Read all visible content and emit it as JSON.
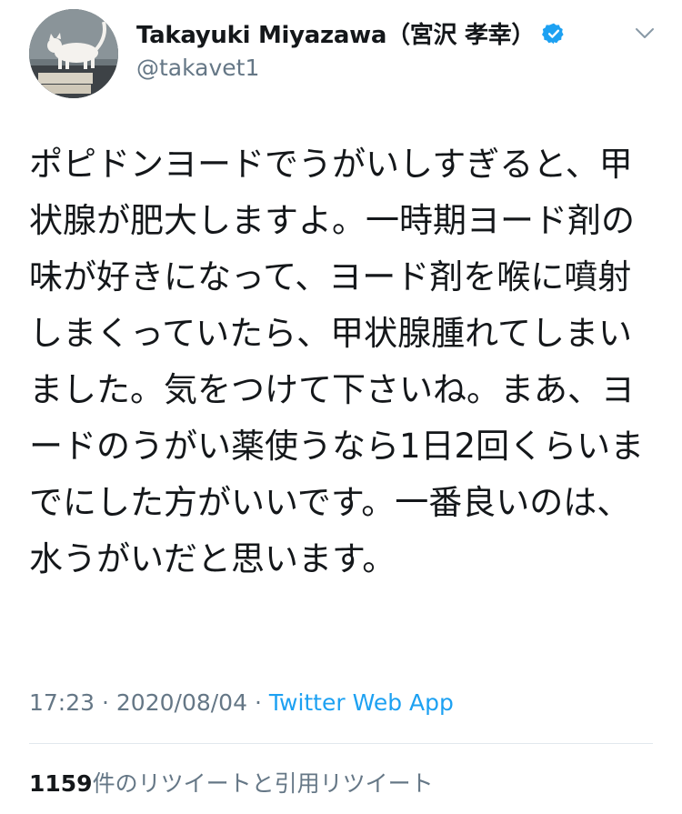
{
  "author": {
    "display_name": "Takayuki Miyazawa（宮沢 孝幸）",
    "handle": "@takavet1",
    "avatar_icon": "cat-photo-avatar",
    "verified_icon": "verified-badge-icon"
  },
  "tweet": {
    "text": "ポピドンヨードでうがいしすぎると、甲状腺が肥大しますよ。一時期ヨード剤の味が好きになって、ヨード剤を喉に噴射しまくっていたら、甲状腺腫れてしまいました。気をつけて下さいね。まあ、ヨードのうがい薬使うなら1日2回くらいまでにした方がいいです。一番良いのは、水うがいだと思います。",
    "time": "17:23",
    "date": "2020/08/04",
    "source": "Twitter Web App"
  },
  "stats": {
    "retweet_count": "1159",
    "retweet_label": "件のリツイートと引用リツイート"
  },
  "colors": {
    "text": "#14171a",
    "secondary": "#657786",
    "accent": "#1da1f2",
    "divider": "#e1e8ed"
  }
}
